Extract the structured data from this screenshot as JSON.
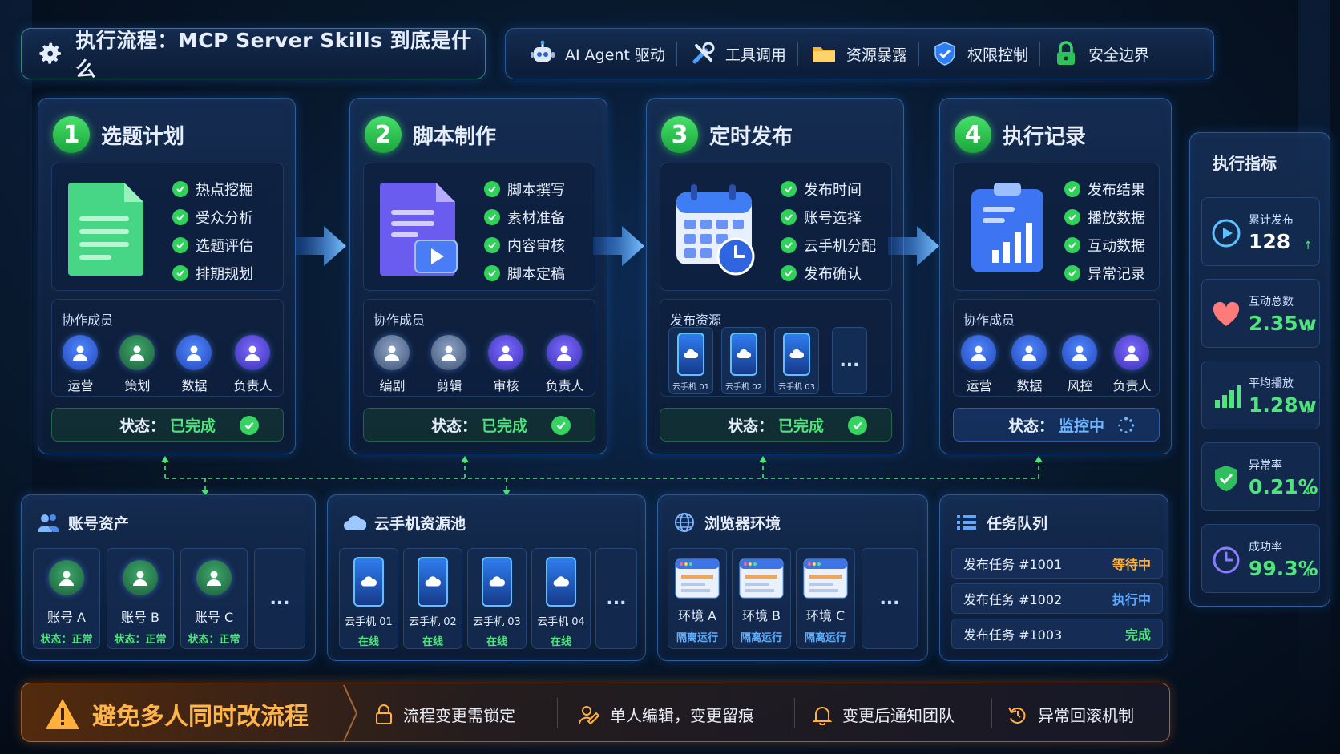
{
  "title": "执行流程：MCP Server Skills 到底是什么",
  "tags": [
    {
      "label": "AI Agent 驱动",
      "icon": "robot-icon"
    },
    {
      "label": "工具调用",
      "icon": "tools-icon"
    },
    {
      "label": "资源暴露",
      "icon": "folder-icon"
    },
    {
      "label": "权限控制",
      "icon": "shield-icon"
    },
    {
      "label": "安全边界",
      "icon": "lock-icon"
    }
  ],
  "steps": [
    {
      "num": "1",
      "title": "选题计划",
      "checks": [
        "热点挖掘",
        "受众分析",
        "选题评估",
        "排期规划"
      ],
      "members_label": "协作成员",
      "members": [
        "运营",
        "策划",
        "数据",
        "负责人"
      ],
      "status_label": "状态：",
      "status_value": "已完成"
    },
    {
      "num": "2",
      "title": "脚本制作",
      "checks": [
        "脚本撰写",
        "素材准备",
        "内容审核",
        "脚本定稿"
      ],
      "members_label": "协作成员",
      "members": [
        "编剧",
        "剪辑",
        "审核",
        "负责人"
      ],
      "status_label": "状态：",
      "status_value": "已完成"
    },
    {
      "num": "3",
      "title": "定时发布",
      "checks": [
        "发布时间",
        "账号选择",
        "云手机分配",
        "发布确认"
      ],
      "resources_label": "发布资源",
      "resources": [
        "云手机 01",
        "云手机 02",
        "云手机 03"
      ],
      "more": "...",
      "status_label": "状态：",
      "status_value": "已完成"
    },
    {
      "num": "4",
      "title": "执行记录",
      "checks": [
        "发布结果",
        "播放数据",
        "互动数据",
        "异常记录"
      ],
      "members_label": "协作成员",
      "members": [
        "运营",
        "数据",
        "风控",
        "负责人"
      ],
      "status_label": "状态：",
      "status_value": "监控中"
    }
  ],
  "accounts": {
    "title": "账号资产",
    "items": [
      {
        "name": "账号 A",
        "status": "状态：正常"
      },
      {
        "name": "账号 B",
        "status": "状态：正常"
      },
      {
        "name": "账号 C",
        "status": "状态：正常"
      }
    ],
    "more": "..."
  },
  "phones": {
    "title": "云手机资源池",
    "items": [
      {
        "name": "云手机 01",
        "status": "在线"
      },
      {
        "name": "云手机 02",
        "status": "在线"
      },
      {
        "name": "云手机 03",
        "status": "在线"
      },
      {
        "name": "云手机 04",
        "status": "在线"
      }
    ],
    "more": "..."
  },
  "browsers": {
    "title": "浏览器环境",
    "items": [
      {
        "name": "环境 A",
        "status": "隔离运行"
      },
      {
        "name": "环境 B",
        "status": "隔离运行"
      },
      {
        "name": "环境 C",
        "status": "隔离运行"
      }
    ],
    "more": "..."
  },
  "queue": {
    "title": "任务队列",
    "items": [
      {
        "name": "发布任务 #1001",
        "status": "等待中",
        "color": "#ffb13b"
      },
      {
        "name": "发布任务 #1002",
        "status": "执行中",
        "color": "#5ea8ff"
      },
      {
        "name": "发布任务 #1003",
        "status": "完成",
        "color": "#4ee57a"
      }
    ]
  },
  "metrics": {
    "title": "执行指标",
    "items": [
      {
        "label": "累计发布",
        "value": "128",
        "trend": "↑",
        "icon": "play-icon",
        "color": "#ffffff"
      },
      {
        "label": "互动总数",
        "value": "2.35w",
        "trend": "↑",
        "icon": "heart-icon",
        "color": "#4ee57a"
      },
      {
        "label": "平均播放",
        "value": "1.28w",
        "trend": "↑",
        "icon": "bar-chart-icon",
        "color": "#4ee57a"
      },
      {
        "label": "异常率",
        "value": "0.21%",
        "trend": "↓",
        "icon": "shield-check-icon",
        "color": "#4ee57a"
      },
      {
        "label": "成功率",
        "value": "99.3%",
        "trend": "↑",
        "icon": "clock-icon",
        "color": "#4ee57a"
      }
    ]
  },
  "warning": {
    "lead": "避免多人同时改流程",
    "items": [
      "流程变更需锁定",
      "单人编辑，变更留痕",
      "变更后通知团队",
      "异常回滚机制"
    ]
  },
  "colors": {
    "accent_green": "#36d363",
    "accent_blue": "#3f8cff",
    "warning": "#ffb54a"
  }
}
